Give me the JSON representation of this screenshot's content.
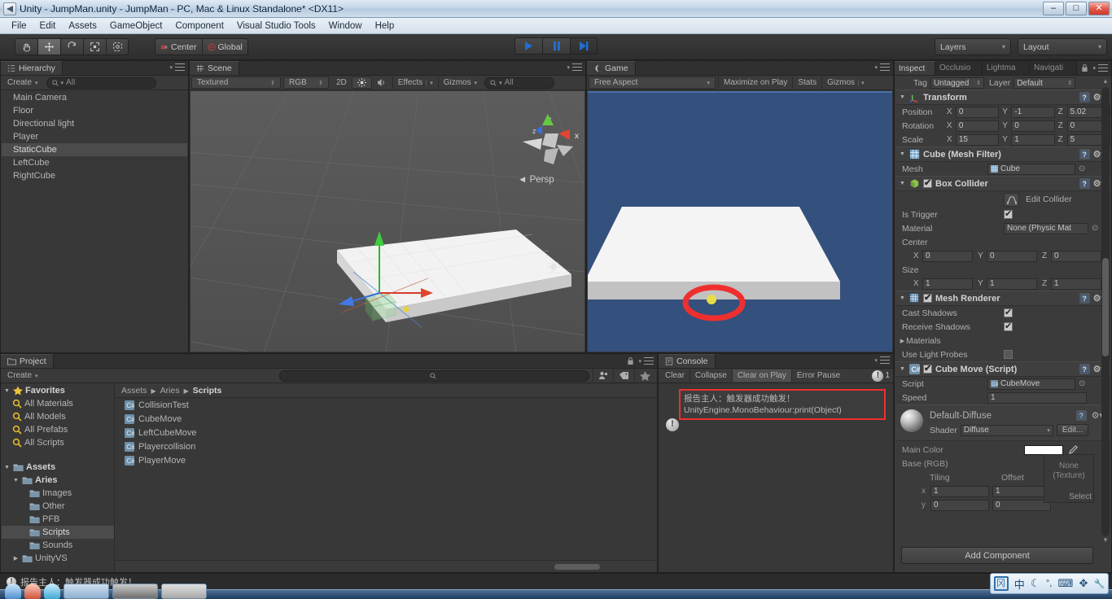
{
  "window": {
    "title": "Unity - JumpMan.unity - JumpMan - PC, Mac & Linux Standalone* <DX11>",
    "minimize": "–",
    "maximize": "□",
    "close": "✕"
  },
  "menubar": {
    "items": [
      "File",
      "Edit",
      "Assets",
      "GameObject",
      "Component",
      "Visual Studio Tools",
      "Window",
      "Help"
    ]
  },
  "toolbar": {
    "tools": [
      "hand-tool",
      "move-tool",
      "rotate-tool",
      "scale-tool",
      "rect-tool"
    ],
    "active_tool": "move-tool",
    "pivot_label": "Center",
    "space_label": "Global",
    "play": "▶",
    "pause": "❚❚",
    "step": "▶|",
    "layers_label": "Layers",
    "layout_label": "Layout",
    "accent_blue": "#2a7fe0"
  },
  "hierarchy": {
    "tab": "Hierarchy",
    "create_label": "Create",
    "search_placeholder": "All",
    "items": [
      {
        "label": "Main Camera",
        "selected": false
      },
      {
        "label": "Floor",
        "selected": false
      },
      {
        "label": "Directional light",
        "selected": false
      },
      {
        "label": "Player",
        "selected": false
      },
      {
        "label": "StaticCube",
        "selected": true
      },
      {
        "label": "LeftCube",
        "selected": false
      },
      {
        "label": "RightCube",
        "selected": false
      }
    ]
  },
  "scene": {
    "tab": "Scene",
    "draw_mode": "Textured",
    "color_mode": "RGB",
    "toggle_2d": "2D",
    "effects_label": "Effects",
    "gizmos_label": "Gizmos",
    "search_placeholder": "All",
    "persp_label": "Persp",
    "axis_x": "x",
    "axis_y": "y",
    "axis_z": "z"
  },
  "game": {
    "tab": "Game",
    "aspect_label": "Free Aspect",
    "maximize_label": "Maximize on Play",
    "stats_label": "Stats",
    "gizmos_label": "Gizmos",
    "bg_color": "#34507d",
    "annotation_color": "#ef2f2f"
  },
  "project": {
    "tab": "Project",
    "create_label": "Create",
    "search_placeholder": "",
    "tree": [
      {
        "label": "Favorites",
        "icon": "star-icon",
        "indent": 0,
        "tri": "▼",
        "bold": true,
        "selected": false
      },
      {
        "label": "All Materials",
        "icon": "search-icon",
        "indent": 1,
        "tri": "",
        "bold": false,
        "selected": false
      },
      {
        "label": "All Models",
        "icon": "search-icon",
        "indent": 1,
        "tri": "",
        "bold": false,
        "selected": false
      },
      {
        "label": "All Prefabs",
        "icon": "search-icon",
        "indent": 1,
        "tri": "",
        "bold": false,
        "selected": false
      },
      {
        "label": "All Scripts",
        "icon": "search-icon",
        "indent": 1,
        "tri": "",
        "bold": false,
        "selected": false
      },
      {
        "label": "",
        "icon": "",
        "indent": 0,
        "tri": "",
        "bold": false,
        "selected": false
      },
      {
        "label": "Assets",
        "icon": "folder-icon",
        "indent": 0,
        "tri": "▼",
        "bold": true,
        "selected": false
      },
      {
        "label": "Aries",
        "icon": "folder-icon",
        "indent": 1,
        "tri": "▼",
        "bold": true,
        "selected": false
      },
      {
        "label": "Images",
        "icon": "folder-icon",
        "indent": 2,
        "tri": "",
        "bold": false,
        "selected": false
      },
      {
        "label": "Other",
        "icon": "folder-icon",
        "indent": 2,
        "tri": "",
        "bold": false,
        "selected": false
      },
      {
        "label": "PFB",
        "icon": "folder-icon",
        "indent": 2,
        "tri": "",
        "bold": false,
        "selected": false
      },
      {
        "label": "Scripts",
        "icon": "folder-icon",
        "indent": 2,
        "tri": "",
        "bold": false,
        "selected": true
      },
      {
        "label": "Sounds",
        "icon": "folder-icon",
        "indent": 2,
        "tri": "",
        "bold": false,
        "selected": false
      },
      {
        "label": "UnityVS",
        "icon": "folder-icon",
        "indent": 1,
        "tri": "▶",
        "bold": false,
        "selected": false
      }
    ],
    "breadcrumb": [
      "Assets",
      "Aries",
      "Scripts"
    ],
    "assets": [
      {
        "label": "CollisionTest",
        "icon": "csharp-script-icon"
      },
      {
        "label": "CubeMove",
        "icon": "csharp-script-icon"
      },
      {
        "label": "LeftCubeMove",
        "icon": "csharp-script-icon"
      },
      {
        "label": "Playercollision",
        "icon": "csharp-script-icon"
      },
      {
        "label": "PlayerMove",
        "icon": "csharp-script-icon"
      }
    ]
  },
  "console": {
    "tab": "Console",
    "buttons": [
      "Clear",
      "Collapse",
      "Clear on Play",
      "Error Pause"
    ],
    "active_button": "Clear on Play",
    "error_count": "1",
    "log": {
      "line1": "报告主人：触发器成功触发！",
      "line2": "UnityEngine.MonoBehaviour:print(Object)",
      "highlight_color": "#ef2f2f"
    }
  },
  "inspector": {
    "tabs": [
      "Inspector",
      "Occlusion",
      "Lightmapping",
      "Navigation"
    ],
    "tabs_short": [
      "Inspect",
      "Occlusio",
      "Lightma",
      "Navigati"
    ],
    "active_tab": "Inspector",
    "tag_label": "Tag",
    "tag_value": "Untagged",
    "layer_label": "Layer",
    "layer_value": "Default",
    "transform": {
      "title": "Transform",
      "rows": [
        {
          "label": "Position",
          "x": "0",
          "y": "-1",
          "z": "5.02"
        },
        {
          "label": "Rotation",
          "x": "0",
          "y": "0",
          "z": "0"
        },
        {
          "label": "Scale",
          "x": "15",
          "y": "1",
          "z": "5"
        }
      ]
    },
    "mesh_filter": {
      "title": "Cube (Mesh Filter)",
      "mesh_label": "Mesh",
      "mesh_value": "Cube"
    },
    "box_collider": {
      "title": "Box Collider",
      "enabled": true,
      "edit_collider_label": "Edit Collider",
      "is_trigger_label": "Is Trigger",
      "is_trigger": true,
      "material_label": "Material",
      "material_value": "None (Physic Mat",
      "center_label": "Center",
      "center": {
        "x": "0",
        "y": "0",
        "z": "0"
      },
      "size_label": "Size",
      "size": {
        "x": "1",
        "y": "1",
        "z": "1"
      }
    },
    "mesh_renderer": {
      "title": "Mesh Renderer",
      "enabled": true,
      "cast_shadows_label": "Cast Shadows",
      "cast_shadows": true,
      "receive_shadows_label": "Receive Shadows",
      "receive_shadows": true,
      "materials_label": "Materials",
      "use_light_probes_label": "Use Light Probes",
      "use_light_probes": false
    },
    "script_component": {
      "title": "Cube Move (Script)",
      "enabled": true,
      "script_label": "Script",
      "script_value": "CubeMove",
      "speed_label": "Speed",
      "speed_value": "1"
    },
    "material": {
      "title": "Default-Diffuse",
      "shader_label": "Shader",
      "shader_value": "Diffuse",
      "edit_label": "Edit...",
      "main_color_label": "Main Color",
      "main_color": "#ffffff",
      "base_rgb_label": "Base (RGB)",
      "texture_none_label": "None\n(Texture)",
      "select_label": "Select",
      "tiling_label": "Tiling",
      "offset_label": "Offset",
      "tiling": {
        "x": "1",
        "y": "0"
      },
      "offset": {
        "x": "1",
        "y": "0"
      },
      "row_x": "x",
      "row_y": "y"
    },
    "add_component_label": "Add Component"
  },
  "statusbar": {
    "message": "报告主人：触发器成功触发！"
  },
  "ime": {
    "items": [
      "中",
      "☾",
      "°,",
      "⌨",
      "✥",
      "🔧"
    ],
    "logo": "冈"
  }
}
